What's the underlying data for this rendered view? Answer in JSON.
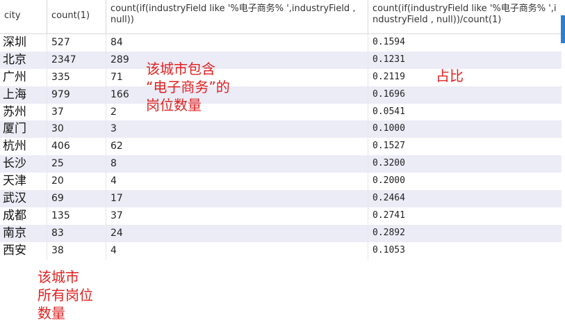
{
  "columns": [
    "city",
    "count(1)",
    "count(if(industryField like '%电子商务% ',industryField , null))",
    "count(if(industryField like '%电子商务% ',industryField , null))/count(1)"
  ],
  "rows": [
    {
      "city": "深圳",
      "count": "527",
      "match": "84",
      "ratio": "0.1594"
    },
    {
      "city": "北京",
      "count": "2347",
      "match": "289",
      "ratio": "0.1231"
    },
    {
      "city": "广州",
      "count": "335",
      "match": "71",
      "ratio": "0.2119"
    },
    {
      "city": "上海",
      "count": "979",
      "match": "166",
      "ratio": "0.1696"
    },
    {
      "city": "苏州",
      "count": "37",
      "match": "2",
      "ratio": "0.0541"
    },
    {
      "city": "厦门",
      "count": "30",
      "match": "3",
      "ratio": "0.1000"
    },
    {
      "city": "杭州",
      "count": "406",
      "match": "62",
      "ratio": "0.1527"
    },
    {
      "city": "长沙",
      "count": "25",
      "match": "8",
      "ratio": "0.3200"
    },
    {
      "city": "天津",
      "count": "20",
      "match": "4",
      "ratio": "0.2000"
    },
    {
      "city": "武汉",
      "count": "69",
      "match": "17",
      "ratio": "0.2464"
    },
    {
      "city": "成都",
      "count": "135",
      "match": "37",
      "ratio": "0.2741"
    },
    {
      "city": "南京",
      "count": "83",
      "match": "24",
      "ratio": "0.2892"
    },
    {
      "city": "西安",
      "count": "38",
      "match": "4",
      "ratio": "0.1053"
    }
  ],
  "annotations": {
    "match_count": [
      "该城市包含",
      "“电子商务”的",
      "岗位数量"
    ],
    "ratio": [
      "占比"
    ],
    "total_count": [
      "该城市",
      "所有岗位",
      "数量"
    ]
  },
  "colors": {
    "annotation": "#e02020",
    "row_alt": "#ececf7",
    "scrollbar": "#2a7fd4"
  }
}
